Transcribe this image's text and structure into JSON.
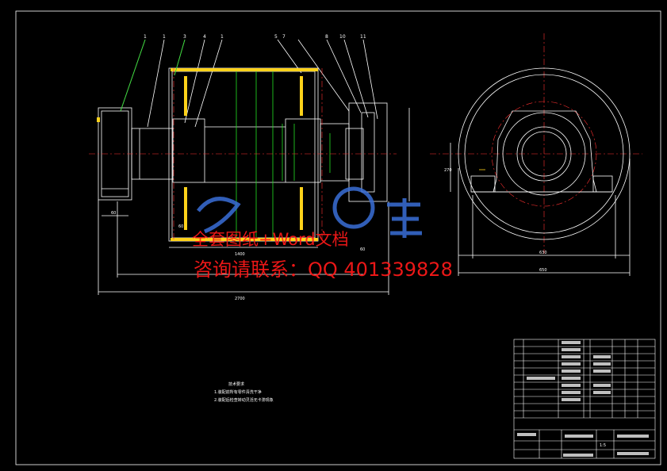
{
  "part_labels": [
    "1",
    "1",
    "3",
    "4",
    "1",
    "5",
    "7",
    "8",
    "10",
    "11"
  ],
  "dimensions": {
    "d1": "1400",
    "d2": "2700",
    "d3": "60",
    "d4": "60",
    "d5": "60",
    "d6": "630",
    "d7": "650",
    "d8": "270"
  },
  "watermark": {
    "line1": "全套图纸+Word文档",
    "line2": "咨询请联系：QQ 401339828"
  },
  "notes": {
    "title": "技术要求",
    "line1": "1.装配前所有零件清洗干净",
    "line2": "2.装配后检查转动灵活无卡滞现象"
  },
  "title_block": {
    "scale": "1:5"
  },
  "colors": {
    "background": "#000000",
    "line": "#ffffff",
    "center": "#ff3030",
    "green": "#22e022",
    "yellow": "#ffd21a",
    "watermark": "#ff1a1a",
    "logo": "#3a6fd8"
  }
}
